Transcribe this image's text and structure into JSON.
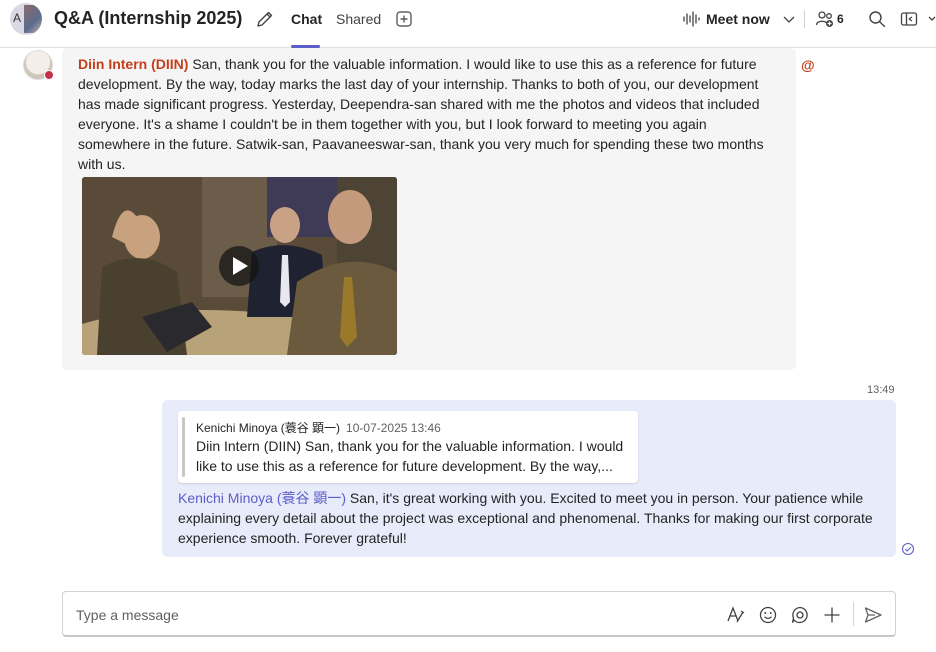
{
  "header": {
    "avatar_letter": "A",
    "title": "Q&A (Internship 2025)",
    "tabs": [
      {
        "label": "Chat",
        "active": true
      },
      {
        "label": "Shared",
        "active": false
      }
    ],
    "meet_label": "Meet now",
    "participant_count": "6",
    "accent_color": "#5b5fc7"
  },
  "messages": [
    {
      "sender": "Diin Intern (DIIN)",
      "body": " San, thank you for the valuable information. I would like to use this as a reference for future development. By the way, today marks the last day of your internship. Thanks to both of you, our development has made significant progress.  Yesterday, Deependra-san shared with me the photos and videos that included everyone. It's a shame I couldn't be in them together with you, but I look forward to meeting you again somewhere in the future. Satwik-san, Paavaneeswar-san, thank you very much for spending these two months with us.",
      "mention_symbol": "@",
      "sender_color": "#c43e1c"
    },
    {
      "time": "13:49",
      "quote": {
        "author": "Kenichi Minoya (蓑谷 顕一)",
        "timestamp": "10-07-2025 13:46",
        "text": "Diin Intern (DIIN) San, thank you for the valuable information. I would like to use this as a reference for future development. By the way,..."
      },
      "mention": "Kenichi Minoya (蓑谷 顕一)",
      "body": " San, it's great working with you. Excited to meet you in person. Your patience while explaining every detail about the project was exceptional and phenomenal. Thanks for making our first corporate experience smooth. Forever grateful!"
    }
  ],
  "composer": {
    "placeholder": "Type a message"
  }
}
